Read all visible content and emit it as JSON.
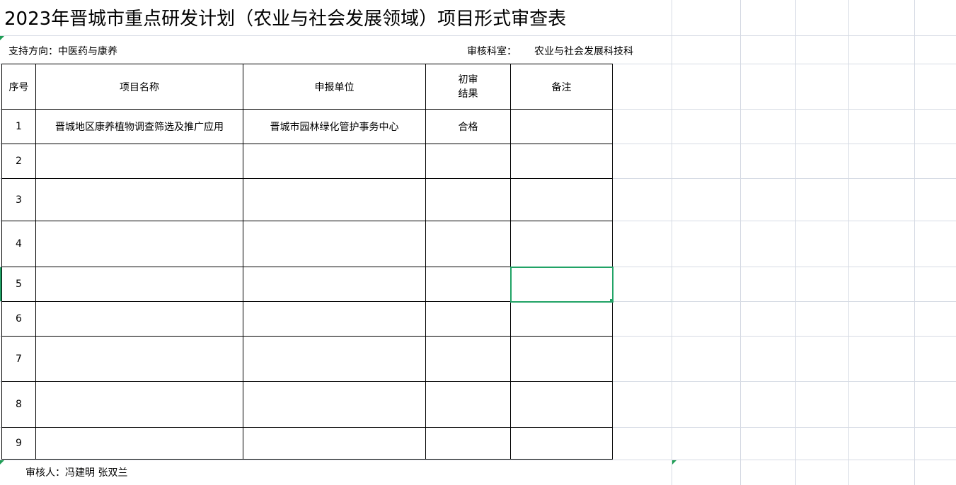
{
  "sheet": {
    "title": "2023年晋城市重点研发计划（农业与社会发展领域）项目形式审查表",
    "support_direction": "支持方向：中医药与康养",
    "dept_label": "审核科室：",
    "dept_value": "农业与社会发展科技科",
    "headers": {
      "no": "序号",
      "name": "项目名称",
      "unit": "申报单位",
      "result_line1": "初审",
      "result_line2": "结果",
      "note": "备注"
    },
    "rows": [
      {
        "no": "1",
        "name": "晋城地区康养植物调查筛选及推广应用",
        "unit": "晋城市园林绿化管护事务中心",
        "result": "合格",
        "note": ""
      },
      {
        "no": "2",
        "name": "",
        "unit": "",
        "result": "",
        "note": ""
      },
      {
        "no": "3",
        "name": "",
        "unit": "",
        "result": "",
        "note": ""
      },
      {
        "no": "4",
        "name": "",
        "unit": "",
        "result": "",
        "note": ""
      },
      {
        "no": "5",
        "name": "",
        "unit": "",
        "result": "",
        "note": ""
      },
      {
        "no": "6",
        "name": "",
        "unit": "",
        "result": "",
        "note": ""
      },
      {
        "no": "7",
        "name": "",
        "unit": "",
        "result": "",
        "note": ""
      },
      {
        "no": "8",
        "name": "",
        "unit": "",
        "result": "",
        "note": ""
      },
      {
        "no": "9",
        "name": "",
        "unit": "",
        "result": "",
        "note": ""
      }
    ],
    "reviewer": "审核人：冯建明   张双兰"
  },
  "colors": {
    "selection": "#21a366",
    "gridline": "#d6dbe4"
  }
}
